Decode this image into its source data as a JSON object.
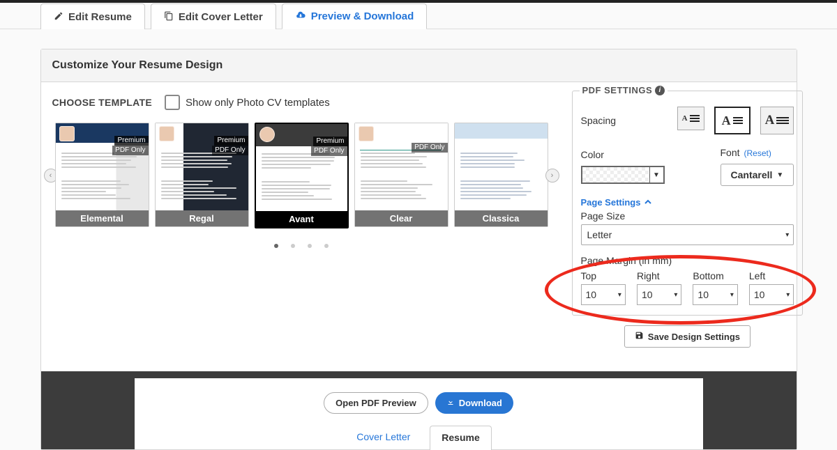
{
  "tabs": {
    "edit_resume": "Edit Resume",
    "edit_cover": "Edit Cover Letter",
    "preview": "Preview & Download"
  },
  "panel": {
    "title": "Customize Your Resume Design",
    "choose": "CHOOSE TEMPLATE",
    "show_only": "Show only Photo CV templates"
  },
  "templates": [
    {
      "name": "Elemental",
      "klass": "t-elemental",
      "premium": "Premium",
      "pdf_only": "PDF Only"
    },
    {
      "name": "Regal",
      "klass": "t-regal",
      "premium": "Premium",
      "pdf_only": "PDF Only"
    },
    {
      "name": "Avant",
      "klass": "t-avant",
      "premium": "Premium",
      "pdf_only": "PDF Only",
      "selected": true
    },
    {
      "name": "Clear",
      "klass": "t-clear",
      "pdf_only": "PDF Only"
    },
    {
      "name": "Classica",
      "klass": "t-classica"
    }
  ],
  "pdf": {
    "legend": "PDF SETTINGS",
    "spacing_label": "Spacing",
    "color_label": "Color",
    "font_label": "Font",
    "reset": "(Reset)",
    "font_value": "Cantarell",
    "page_settings": "Page Settings",
    "page_size_label": "Page Size",
    "page_size_value": "Letter",
    "margin_label": "Page Margin (in mm)",
    "margins": {
      "top": {
        "label": "Top",
        "value": "10"
      },
      "right": {
        "label": "Right",
        "value": "10"
      },
      "bottom": {
        "label": "Bottom",
        "value": "10"
      },
      "left": {
        "label": "Left",
        "value": "10"
      }
    },
    "save": "Save Design Settings"
  },
  "preview_bar": {
    "open_pdf": "Open PDF Preview",
    "download": "Download",
    "cover_letter": "Cover Letter",
    "resume": "Resume"
  }
}
